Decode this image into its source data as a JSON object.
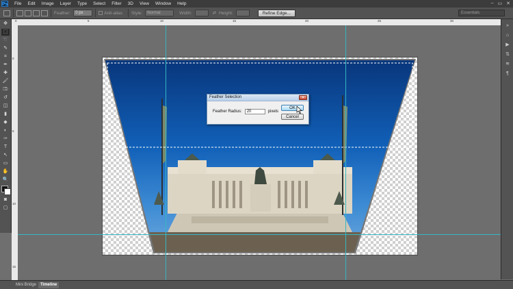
{
  "app": {
    "logo": "Ps"
  },
  "menu": [
    "File",
    "Edit",
    "Image",
    "Layer",
    "Type",
    "Select",
    "Filter",
    "3D",
    "View",
    "Window",
    "Help"
  ],
  "window_controls": [
    "–",
    "▭",
    "✕"
  ],
  "options": {
    "feather_label": "Feather:",
    "feather_value": "0 px",
    "antialias_label": "Anti-alias",
    "style_label": "Style:",
    "style_value": "Normal",
    "width_label": "Width:",
    "height_label": "Height:",
    "refine_label": "Refine Edge...",
    "workspace": "Essentials"
  },
  "tools": [
    "move-icon",
    "marquee-icon",
    "lasso-icon",
    "quick-select-icon",
    "crop-icon",
    "eyedropper-icon",
    "healing-icon",
    "brush-icon",
    "stamp-icon",
    "history-brush-icon",
    "eraser-icon",
    "gradient-icon",
    "blur-icon",
    "dodge-icon",
    "pen-icon",
    "type-icon",
    "path-select-icon",
    "shape-icon",
    "hand-icon",
    "zoom-icon"
  ],
  "tool_glyphs": [
    "✥",
    "⬚",
    "➰",
    "✎",
    "⌗",
    "✒",
    "✚",
    "🖌",
    "⎄",
    "↺",
    "◫",
    "▮",
    "◆",
    "◐",
    "✑",
    "T",
    "↖",
    "▭",
    "✋",
    "🔍"
  ],
  "ruler_top": [
    "0",
    "5",
    "10",
    "15",
    "20",
    "25",
    "30"
  ],
  "ruler_left": [
    "0",
    "5",
    "10",
    "15"
  ],
  "right_panel": [
    "»",
    "⌂",
    "▶",
    "⇅",
    "≋",
    "¶"
  ],
  "dialog": {
    "title": "Feather Selection",
    "close": "✕",
    "field_label": "Feather Radius:",
    "field_value": "20",
    "unit": "pixels",
    "ok": "OK",
    "cancel": "Cancel"
  },
  "bottom_tabs": [
    "Mini Bridge",
    "Timeline"
  ],
  "colors": {
    "accent": "#35b6c2",
    "sky": "#0f4fa0",
    "panel": "#535353"
  }
}
